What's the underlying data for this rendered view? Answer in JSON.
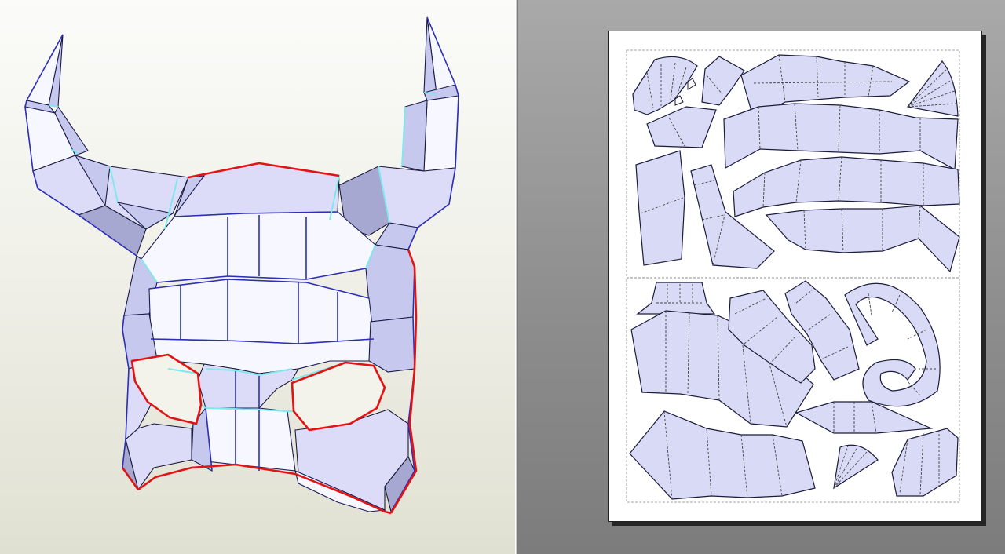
{
  "app": {
    "panes": [
      "3d-model-view",
      "2d-unfold-view"
    ]
  },
  "colors": {
    "face_fill": "#d9daf6",
    "face_dark": "#a7a8d2",
    "edge_blue": "#2d2fb8",
    "edge_red": "#e01414",
    "edge_cyan": "#7fe8ec",
    "paper": "#ffffff",
    "workspace_bg": "#8e8e8e",
    "viewport_bg": "#f1f1ea"
  },
  "model": {
    "subject": "horned mask"
  },
  "sheet": {
    "pages_visible": 2
  }
}
